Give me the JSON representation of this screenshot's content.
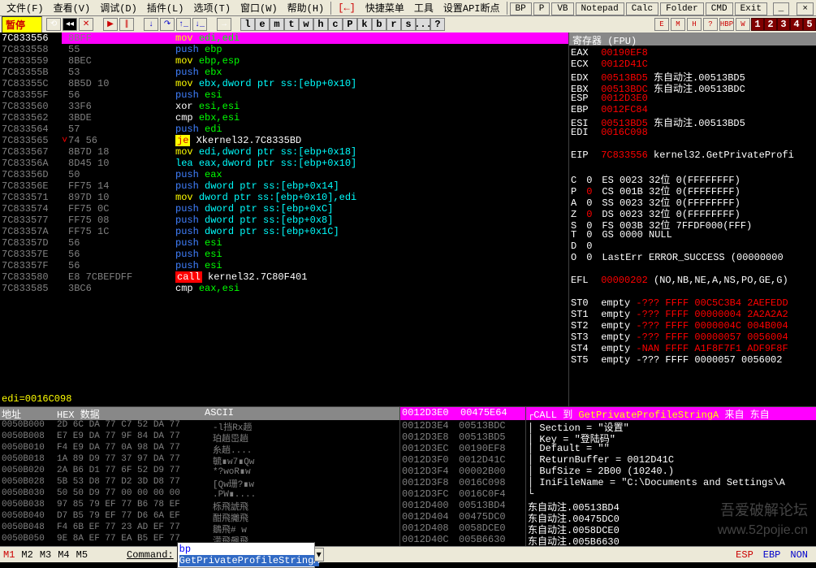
{
  "menu": {
    "file": "文件(F)",
    "view": "查看(V)",
    "debug": "调试(D)",
    "plugin": "插件(L)",
    "option": "选项(T)",
    "window": "窗口(W)",
    "help": "帮助(H)",
    "quick": "快捷菜单",
    "tools": "工具",
    "setapi": "设置API断点"
  },
  "menubtns": [
    "BP",
    "P",
    "VB",
    "Notepad",
    "Calc",
    "Folder",
    "CMD",
    "Exit"
  ],
  "status": "暂停",
  "letters": [
    "l",
    "e",
    "m",
    "t",
    "w",
    "h",
    "c",
    "P",
    "k",
    "b",
    "r",
    "s",
    "...",
    "?"
  ],
  "smallbtns": [
    "E",
    "M",
    "H",
    "?",
    "HBP",
    "W"
  ],
  "nums": [
    "1",
    "2",
    "3",
    "4",
    "5"
  ],
  "disasm": [
    {
      "addr": "7C833556",
      "bytes": "8BFF",
      "pre": "mov",
      "op": "edi,edi",
      "c1": "col-yellow",
      "c2": "col-green",
      "hl": true
    },
    {
      "addr": "7C833558",
      "bytes": "55",
      "pre": "push",
      "op": "ebp",
      "c1": "col-blue",
      "c2": "col-green"
    },
    {
      "addr": "7C833559",
      "bytes": "8BEC",
      "pre": "mov",
      "op": "ebp,esp",
      "c1": "col-yellow",
      "c2": "col-green"
    },
    {
      "addr": "7C83355B",
      "bytes": "53",
      "pre": "push",
      "op": "ebx",
      "c1": "col-blue",
      "c2": "col-green"
    },
    {
      "addr": "7C83355C",
      "bytes": "8B5D 10",
      "pre": "mov",
      "op": "ebx,dword ptr ss:[ebp+0x10]",
      "c1": "col-yellow",
      "c2": "col-cyan"
    },
    {
      "addr": "7C83355F",
      "bytes": "56",
      "pre": "push",
      "op": "esi",
      "c1": "col-blue",
      "c2": "col-green"
    },
    {
      "addr": "7C833560",
      "bytes": "33F6",
      "pre": "xor",
      "op": "esi,esi",
      "c1": "col-white",
      "c2": "col-green"
    },
    {
      "addr": "7C833562",
      "bytes": "3BDE",
      "pre": "cmp",
      "op": "ebx,esi",
      "c1": "col-white",
      "c2": "col-green"
    },
    {
      "addr": "7C833564",
      "bytes": "57",
      "pre": "push",
      "op": "edi",
      "c1": "col-blue",
      "c2": "col-green"
    },
    {
      "addr": "7C833565",
      "bytes": "74 56",
      "pre": "je",
      "op": "Xkernel32.7C8335BD",
      "c1": "bg-yellow",
      "c2": "col-white",
      "mark": "˅"
    },
    {
      "addr": "7C833567",
      "bytes": "8B7D 18",
      "pre": "mov",
      "op": "edi,dword ptr ss:[ebp+0x18]",
      "c1": "col-yellow",
      "c2": "col-cyan"
    },
    {
      "addr": "7C83356A",
      "bytes": "8D45 10",
      "pre": "lea",
      "op": "eax,dword ptr ss:[ebp+0x10]",
      "c1": "col-cyan",
      "c2": "col-cyan"
    },
    {
      "addr": "7C83356D",
      "bytes": "50",
      "pre": "push",
      "op": "eax",
      "c1": "col-blue",
      "c2": "col-green"
    },
    {
      "addr": "7C83356E",
      "bytes": "FF75 14",
      "pre": "push",
      "op": "dword ptr ss:[ebp+0x14]",
      "c1": "col-blue",
      "c2": "col-cyan"
    },
    {
      "addr": "7C833571",
      "bytes": "897D 10",
      "pre": "mov",
      "op": "dword ptr ss:[ebp+0x10],edi",
      "c1": "col-yellow",
      "c2": "col-cyan"
    },
    {
      "addr": "7C833574",
      "bytes": "FF75 0C",
      "pre": "push",
      "op": "dword ptr ss:[ebp+0xC]",
      "c1": "col-blue",
      "c2": "col-cyan"
    },
    {
      "addr": "7C833577",
      "bytes": "FF75 08",
      "pre": "push",
      "op": "dword ptr ss:[ebp+0x8]",
      "c1": "col-blue",
      "c2": "col-cyan"
    },
    {
      "addr": "7C83357A",
      "bytes": "FF75 1C",
      "pre": "push",
      "op": "dword ptr ss:[ebp+0x1C]",
      "c1": "col-blue",
      "c2": "col-cyan"
    },
    {
      "addr": "7C83357D",
      "bytes": "56",
      "pre": "push",
      "op": "esi",
      "c1": "col-blue",
      "c2": "col-green"
    },
    {
      "addr": "7C83357E",
      "bytes": "56",
      "pre": "push",
      "op": "esi",
      "c1": "col-blue",
      "c2": "col-green"
    },
    {
      "addr": "7C83357F",
      "bytes": "56",
      "pre": "push",
      "op": "esi",
      "c1": "col-blue",
      "c2": "col-green"
    },
    {
      "addr": "7C833580",
      "bytes": "E8 7CBEFDFF",
      "pre": "call",
      "op": "kernel32.7C80F401",
      "c1": "bg-red",
      "c2": "col-white"
    },
    {
      "addr": "7C833585",
      "bytes": "3BC6",
      "pre": "cmp",
      "op": "eax,esi",
      "c1": "col-white",
      "c2": "col-green"
    }
  ],
  "infoline": "edi=0016C098",
  "regs_hdr": "寄存器 (FPU)",
  "regs": [
    {
      "n": "EAX",
      "v": "00190EF8"
    },
    {
      "n": "ECX",
      "v": "0012D41C"
    },
    {
      "n": "EDX",
      "v": "00513BD5",
      "note": "东自动注.00513BD5"
    },
    {
      "n": "EBX",
      "v": "00513BDC",
      "note": "东自动注.00513BDC"
    },
    {
      "n": "ESP",
      "v": "0012D3E0"
    },
    {
      "n": "EBP",
      "v": "0012FC84"
    },
    {
      "n": "ESI",
      "v": "00513BD5",
      "note": "东自动注.00513BD5"
    },
    {
      "n": "EDI",
      "v": "0016C098"
    }
  ],
  "eip": {
    "n": "EIP",
    "v": "7C833556",
    "note": "kernel32.GetPrivateProfi"
  },
  "flags": [
    {
      "n": "C",
      "v": "0",
      "seg": "ES 0023",
      "note": "32位 0(FFFFFFFF)"
    },
    {
      "n": "P",
      "v": "0",
      "seg": "CS 001B",
      "note": "32位 0(FFFFFFFF)",
      "red": true
    },
    {
      "n": "A",
      "v": "0",
      "seg": "SS 0023",
      "note": "32位 0(FFFFFFFF)"
    },
    {
      "n": "Z",
      "v": "0",
      "seg": "DS 0023",
      "note": "32位 0(FFFFFFFF)",
      "red": true
    },
    {
      "n": "S",
      "v": "0",
      "seg": "FS 003B",
      "note": "32位 7FFDF000(FFF)"
    },
    {
      "n": "T",
      "v": "0",
      "seg": "GS 0000",
      "note": "NULL"
    },
    {
      "n": "D",
      "v": "0"
    },
    {
      "n": "O",
      "v": "0",
      "seg": "LastErr",
      "note": "ERROR_SUCCESS (00000000"
    }
  ],
  "efl": {
    "n": "EFL",
    "v": "00000202",
    "note": "(NO,NB,NE,A,NS,PO,GE,G)"
  },
  "fpu": [
    {
      "n": "ST0",
      "s": "empty",
      "v": "-??? FFFF 00C5C3B4 2AEFEDD",
      "red": true
    },
    {
      "n": "ST1",
      "s": "empty",
      "v": "-??? FFFF 00000004 2A2A2A2",
      "red": true
    },
    {
      "n": "ST2",
      "s": "empty",
      "v": "-??? FFFF 0000004C 004B004",
      "red": true
    },
    {
      "n": "ST3",
      "s": "empty",
      "v": "-??? FFFF 00000057 0056004",
      "red": true
    },
    {
      "n": "ST4",
      "s": "empty",
      "v": "-NAN FFFF A1F8F7F1 ADF9F8F",
      "red": true
    },
    {
      "n": "ST5",
      "s": "empty",
      "v": "-??? FFFF 0000057 0056002",
      "red": false
    }
  ],
  "hex_hdr": {
    "addr": "地址",
    "data": "HEX 数据",
    "ascii": "ASCII"
  },
  "hex": [
    {
      "a": "0050B000",
      "b": "2D 6C DA 77 C7 52 DA 77",
      "c": "-l挡Rx趟"
    },
    {
      "a": "0050B008",
      "b": "E7 E9 DA 77 9F 84 DA 77",
      "c": "珀趟岊趟"
    },
    {
      "a": "0050B010",
      "b": "F4 E9 DA 77 0A 98 DA 77",
      "c": "糸趟...."
    },
    {
      "a": "0050B018",
      "b": "1A 89 D9 77 37 97 DA 77",
      "c": "毓∎w7∎Qw"
    },
    {
      "a": "0050B020",
      "b": "2A B6 D1 77 6F 52 D9 77",
      "c": "*?woR∎w"
    },
    {
      "a": "0050B028",
      "b": "5B 53 D8 77 D2 3D D8 77",
      "c": "[Qw珊?∎w"
    },
    {
      "a": "0050B030",
      "b": "50 50 D9 77 00 00 00 00",
      "c": ".PW∎...."
    },
    {
      "a": "0050B038",
      "b": "97 85 79 EF 77 B6 78 EF",
      "c": "栎飛諕飛"
    },
    {
      "a": "0050B040",
      "b": "D7 B5 79 EF 77 D6 6A EF",
      "c": "酣飛攡飛"
    },
    {
      "a": "0050B048",
      "b": "F4 6B EF 77 23 AD EF 77",
      "c": "鶵飛# w"
    },
    {
      "a": "0050B050",
      "b": "9E 8A EF 77 EA B5 EF 77",
      "c": "濛飛飆飛"
    }
  ],
  "stack_hdr": "0012D3E0",
  "stack_val": "00475E64",
  "stack": [
    {
      "a": "0012D3E4",
      "b": "00513BDC"
    },
    {
      "a": "0012D3E8",
      "b": "00513BD5"
    },
    {
      "a": "0012D3EC",
      "b": "00190EF8"
    },
    {
      "a": "0012D3F0",
      "b": "0012D41C"
    },
    {
      "a": "0012D3F4",
      "b": "00002B00"
    },
    {
      "a": "0012D3F8",
      "b": "0016C098"
    },
    {
      "a": "0012D3FC",
      "b": "0016C0F4"
    },
    {
      "a": "0012D400",
      "b": "00513BD4"
    },
    {
      "a": "0012D404",
      "b": "00475DC0"
    },
    {
      "a": "0012D408",
      "b": "0058DCE0"
    },
    {
      "a": "0012D40C",
      "b": "005B6630"
    }
  ],
  "call_hdr_pre": "CALL 到 ",
  "call_hdr_fn": "GetPrivateProfileStringA",
  "call_hdr_post": " 来自 东自",
  "call": [
    "Section = \"设置\"",
    "Key = \"登陆码\"",
    "Default = \"\"",
    "ReturnBuffer = 0012D41C",
    "BufSize = 2B00 (10240.)",
    "IniFileName = \"C:\\Documents and Settings\\A",
    "",
    "东自动注.00513BD4",
    "东自动注.00475DC0",
    "东自动注.0058DCE0",
    "东自动注.005B6630"
  ],
  "marks": [
    "M1",
    "M2",
    "M3",
    "M4",
    "M5"
  ],
  "cmd_label": "Command:",
  "cmd_pre": "bp ",
  "cmd_sel": "GetPrivateProfileStringA",
  "bottom_right": [
    "ESP",
    "EBP",
    "NON"
  ],
  "watermark": "www.52pojie.cn",
  "watermark2": "吾爱破解论坛"
}
